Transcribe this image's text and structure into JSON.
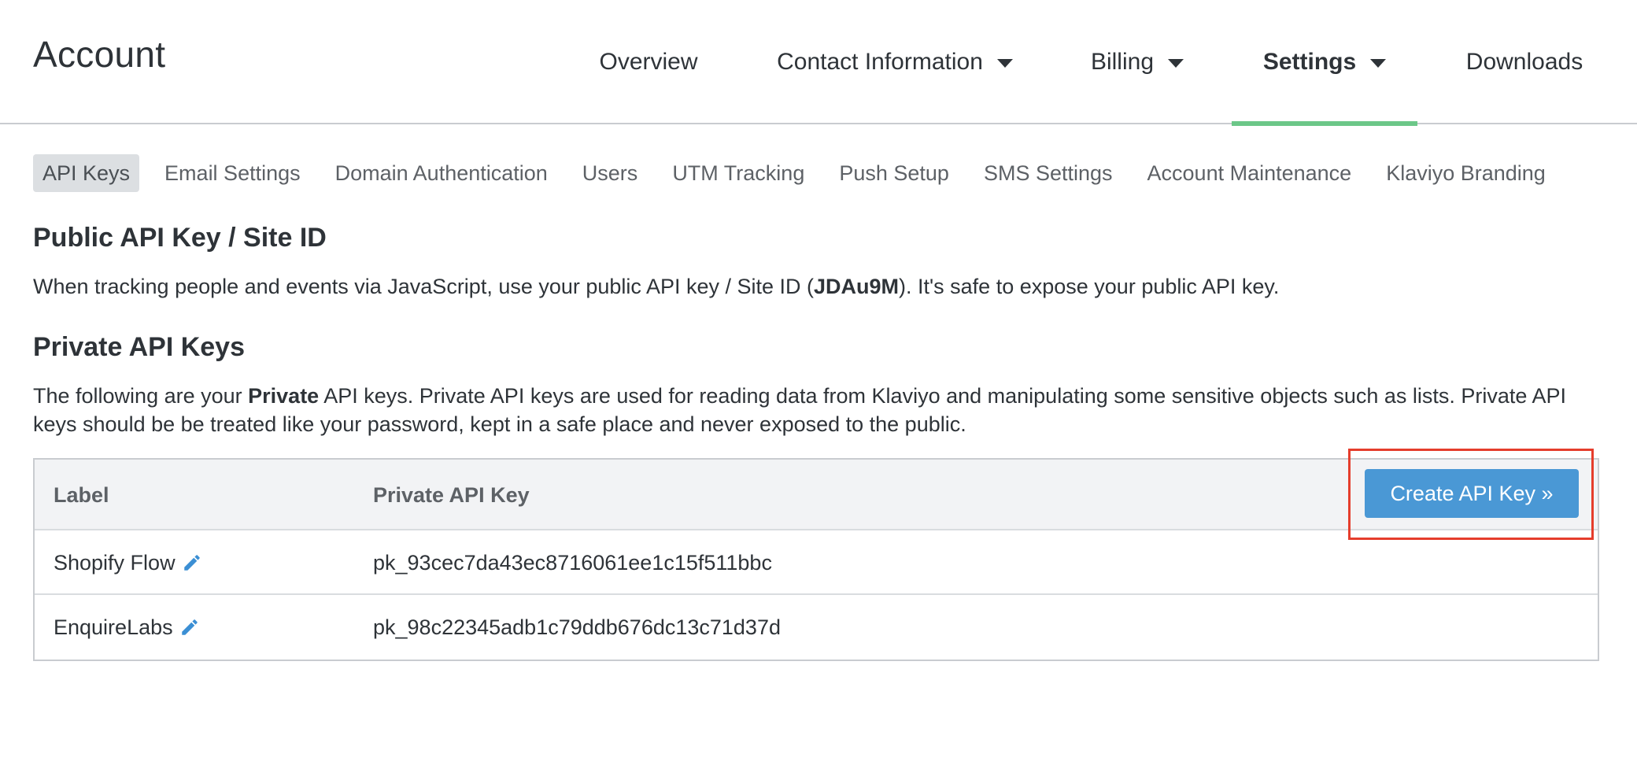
{
  "header": {
    "title": "Account",
    "nav": [
      {
        "label": "Overview",
        "dropdown": false,
        "active": false
      },
      {
        "label": "Contact Information",
        "dropdown": true,
        "active": false
      },
      {
        "label": "Billing",
        "dropdown": true,
        "active": false
      },
      {
        "label": "Settings",
        "dropdown": true,
        "active": true
      },
      {
        "label": "Downloads",
        "dropdown": false,
        "active": false
      }
    ]
  },
  "sub_tabs": [
    {
      "label": "API Keys",
      "active": true
    },
    {
      "label": "Email Settings",
      "active": false
    },
    {
      "label": "Domain Authentication",
      "active": false
    },
    {
      "label": "Users",
      "active": false
    },
    {
      "label": "UTM Tracking",
      "active": false
    },
    {
      "label": "Push Setup",
      "active": false
    },
    {
      "label": "SMS Settings",
      "active": false
    },
    {
      "label": "Account Maintenance",
      "active": false
    },
    {
      "label": "Klaviyo Branding",
      "active": false
    }
  ],
  "public_section": {
    "title": "Public API Key / Site ID",
    "text_before": "When tracking people and events via JavaScript, use your public API key / Site ID (",
    "site_id": "JDAu9M",
    "text_after": "). It's safe to expose your public API key."
  },
  "private_section": {
    "title": "Private API Keys",
    "text_before": "The following are your ",
    "emphasis": "Private",
    "text_after": " API keys. Private API keys are used for reading data from Klaviyo and manipulating some sensitive objects such as lists. Private API keys should be be treated like your password, kept in a safe place and never exposed to the public."
  },
  "table": {
    "headers": {
      "label": "Label",
      "key": "Private API Key"
    },
    "create_button": "Create API Key »",
    "rows": [
      {
        "label": "Shopify Flow",
        "key": "pk_93cec7da43ec8716061ee1c15f511bbc"
      },
      {
        "label": "EnquireLabs",
        "key": "pk_98c22345adb1c79ddb676dc13c71d37d"
      }
    ]
  },
  "colors": {
    "accent_green": "#6cc788",
    "button_blue": "#4a98d5",
    "highlight_red": "#e53d2c",
    "edit_icon_blue": "#3b8fd4"
  },
  "icons": {
    "edit": "pencil-icon",
    "dropdown": "caret-down-icon"
  }
}
